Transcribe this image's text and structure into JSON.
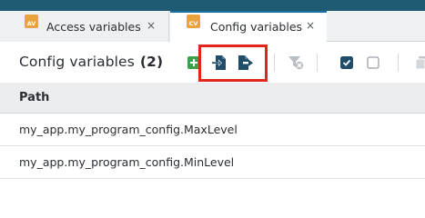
{
  "colors": {
    "top_bar": "#1f5a73",
    "tab_badge": "#e8a33a",
    "active_tab_accent": "#1d6fa5",
    "highlight": "#e0261b",
    "add_icon": "#3aa24a",
    "dark_icon": "#1e4e6a"
  },
  "tabs": [
    {
      "badge": "AV",
      "label": "Access variables",
      "close": "×",
      "active": false
    },
    {
      "badge": "CV",
      "label": "Config variables",
      "close": "×",
      "active": true
    }
  ],
  "toolbar": {
    "title": "Config variables",
    "count": "(2)",
    "icons": [
      "add-icon",
      "import-icon",
      "export-icon",
      "filter-clear-icon",
      "checkbox-checked-icon",
      "checkbox-unchecked-icon",
      "copy-icon"
    ]
  },
  "table": {
    "columns": [
      "Path"
    ],
    "rows": [
      "my_app.my_program_config.MaxLevel",
      "my_app.my_program_config.MinLevel"
    ]
  }
}
